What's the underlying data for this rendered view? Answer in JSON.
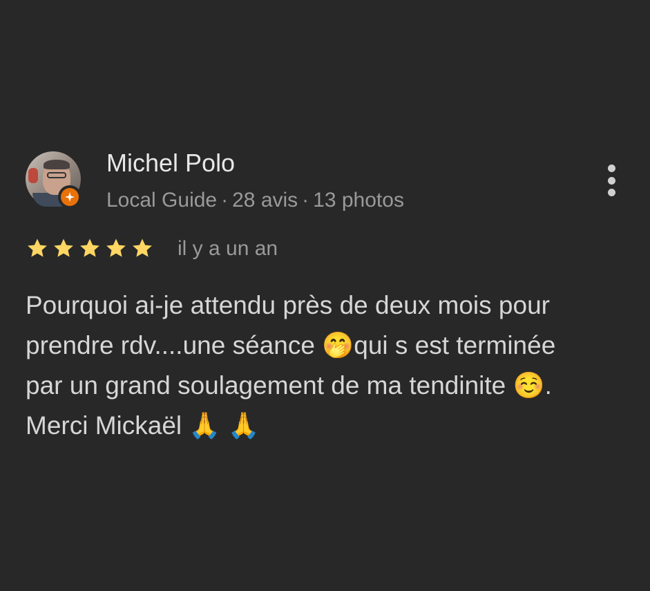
{
  "review": {
    "author_name": "Michel Polo",
    "author_meta": {
      "guide_label": "Local Guide",
      "separator": "·",
      "reviews_count": "28 avis",
      "photos_count": "13 photos"
    },
    "rating": 5,
    "rating_max": 5,
    "date": "il y a un an",
    "text_lines": [
      "Pourquoi ai-je attendu près de deux mois pour",
      "prendre rdv....une séance 🤭qui s est terminée",
      "par un grand soulagement de ma tendinite ☺️.",
      "Merci Mickaël 🙏 🙏"
    ],
    "icons": {
      "avatar": "user-avatar",
      "badge": "local-guide-badge-icon",
      "more": "more-vert-icon",
      "star": "star-icon"
    },
    "colors": {
      "background": "#282828",
      "star": "#fdd663",
      "badge": "#e8710a",
      "primary_text": "#e8e8e8",
      "secondary_text": "#9a9a9a"
    }
  }
}
